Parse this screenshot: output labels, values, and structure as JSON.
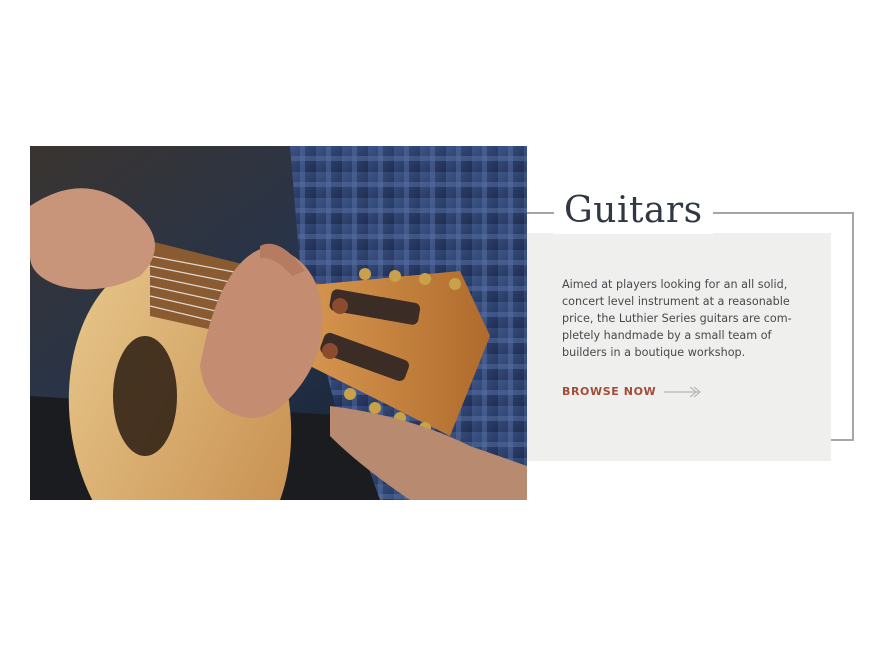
{
  "feature": {
    "title": "Guitars",
    "description": "Aimed at players looking for an all solid, concert level instrument at a reasonable price, the Luthier Series guitars are com-pletely handmade by a small team of builders in a boutique workshop.",
    "cta_label": "BROWSE NOW",
    "image_icon": "photo-guitarist-icon",
    "arrow_icon": "arrow-right-icon"
  },
  "colors": {
    "title": "#303844",
    "body_text": "#46494c",
    "cta": "#a14d37",
    "frame": "#a4a6a8",
    "panel": "#efefee"
  }
}
